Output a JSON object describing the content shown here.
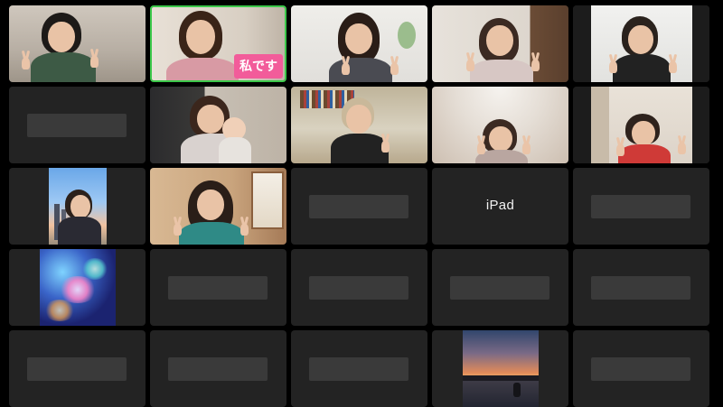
{
  "meeting": {
    "tiles": [
      {
        "id": "r1c1",
        "type": "video",
        "participant": "participant-1"
      },
      {
        "id": "r1c2",
        "type": "video",
        "participant": "participant-2",
        "tag": "私です",
        "active": true
      },
      {
        "id": "r1c3",
        "type": "video",
        "participant": "participant-3"
      },
      {
        "id": "r1c4",
        "type": "video",
        "participant": "participant-4"
      },
      {
        "id": "r1c5",
        "type": "video",
        "participant": "participant-5"
      },
      {
        "id": "r2c1",
        "type": "off"
      },
      {
        "id": "r2c2",
        "type": "video",
        "participant": "participant-6"
      },
      {
        "id": "r2c3",
        "type": "video",
        "participant": "participant-7"
      },
      {
        "id": "r2c4",
        "type": "video",
        "participant": "participant-8"
      },
      {
        "id": "r2c5",
        "type": "video",
        "participant": "participant-9"
      },
      {
        "id": "r3c1",
        "type": "profile-photo"
      },
      {
        "id": "r3c2",
        "type": "video",
        "participant": "participant-10"
      },
      {
        "id": "r3c3",
        "type": "off"
      },
      {
        "id": "r3c4",
        "type": "name",
        "label": "iPad"
      },
      {
        "id": "r3c5",
        "type": "off"
      },
      {
        "id": "r4c1",
        "type": "profile-photo"
      },
      {
        "id": "r4c2",
        "type": "off"
      },
      {
        "id": "r4c3",
        "type": "off"
      },
      {
        "id": "r4c4",
        "type": "off"
      },
      {
        "id": "r4c5",
        "type": "off"
      },
      {
        "id": "r5c1",
        "type": "off"
      },
      {
        "id": "r5c2",
        "type": "off"
      },
      {
        "id": "r5c3",
        "type": "off"
      },
      {
        "id": "r5c4",
        "type": "profile-photo"
      },
      {
        "id": "r5c5",
        "type": "off"
      }
    ],
    "self_tag": "私です",
    "ipad_label": "iPad",
    "colors": {
      "background": "#000000",
      "tile": "#232323",
      "name_placeholder": "#3a3a3a",
      "active_speaker_border": "#3cc84a",
      "self_tag_bg": "#f25c9a"
    }
  }
}
